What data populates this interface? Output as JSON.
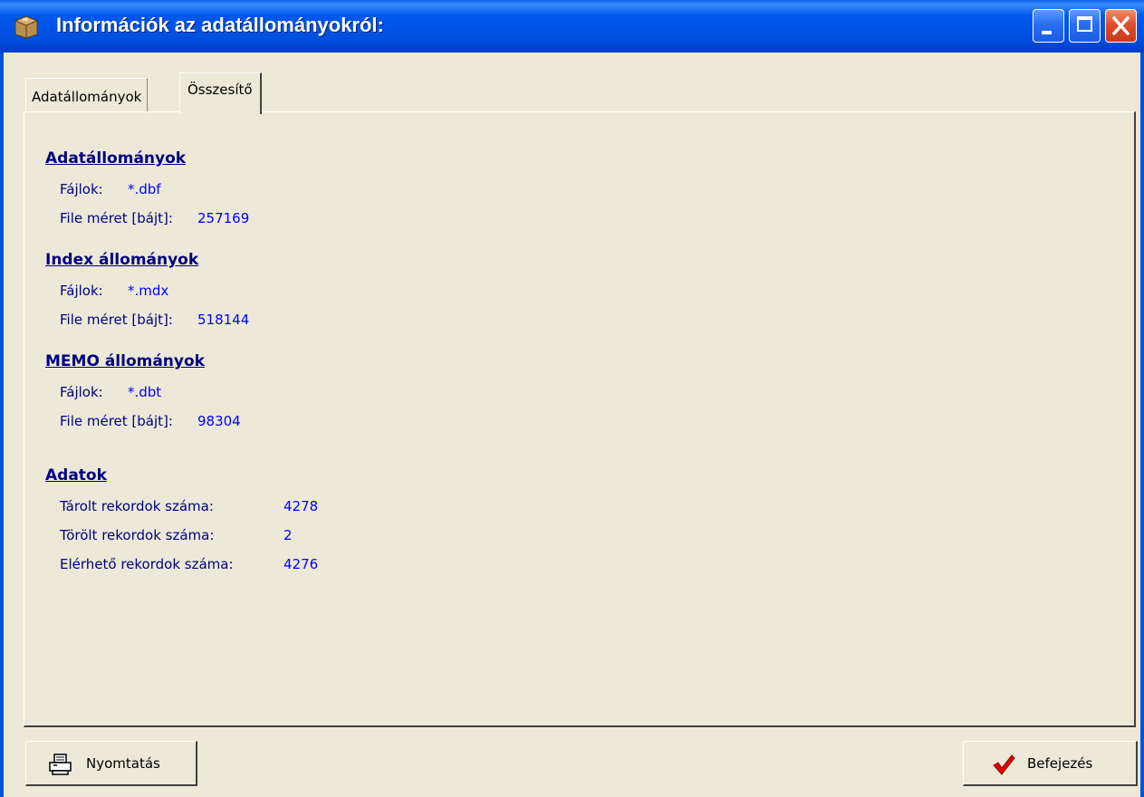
{
  "window": {
    "title": "Információk az adatállományokról:",
    "app_icon": "box-icon"
  },
  "tabs": [
    {
      "label": "Adatállományok",
      "active": false
    },
    {
      "label": "Összesítő",
      "active": true
    }
  ],
  "sections": {
    "data_files": {
      "title": "Adatállományok",
      "files_label": "Fájlok:",
      "files_value": "*.dbf",
      "size_label": "File méret [bájt]:",
      "size_value": "257169"
    },
    "index_files": {
      "title": "Index állományok",
      "files_label": "Fájlok:",
      "files_value": "*.mdx",
      "size_label": "File méret [bájt]:",
      "size_value": "518144"
    },
    "memo_files": {
      "title": "MEMO állományok",
      "files_label": "Fájlok:",
      "files_value": "*.dbt",
      "size_label": "File méret [bájt]:",
      "size_value": "98304"
    },
    "data": {
      "title": "Adatok",
      "stored_label": "Tárolt rekordok száma:",
      "stored_value": "4278",
      "deleted_label": "Törölt rekordok száma:",
      "deleted_value": "2",
      "available_label": "Elérhető rekordok száma:",
      "available_value": "4276"
    }
  },
  "buttons": {
    "print": {
      "label": "Nyomtatás",
      "icon": "printer-icon"
    },
    "finish": {
      "label": "Befejezés",
      "icon": "checkmark-icon"
    }
  },
  "colors": {
    "label": "#000080",
    "value": "#0000ff",
    "window_bg": "#ece9d8",
    "titlebar": "#0054e3"
  }
}
